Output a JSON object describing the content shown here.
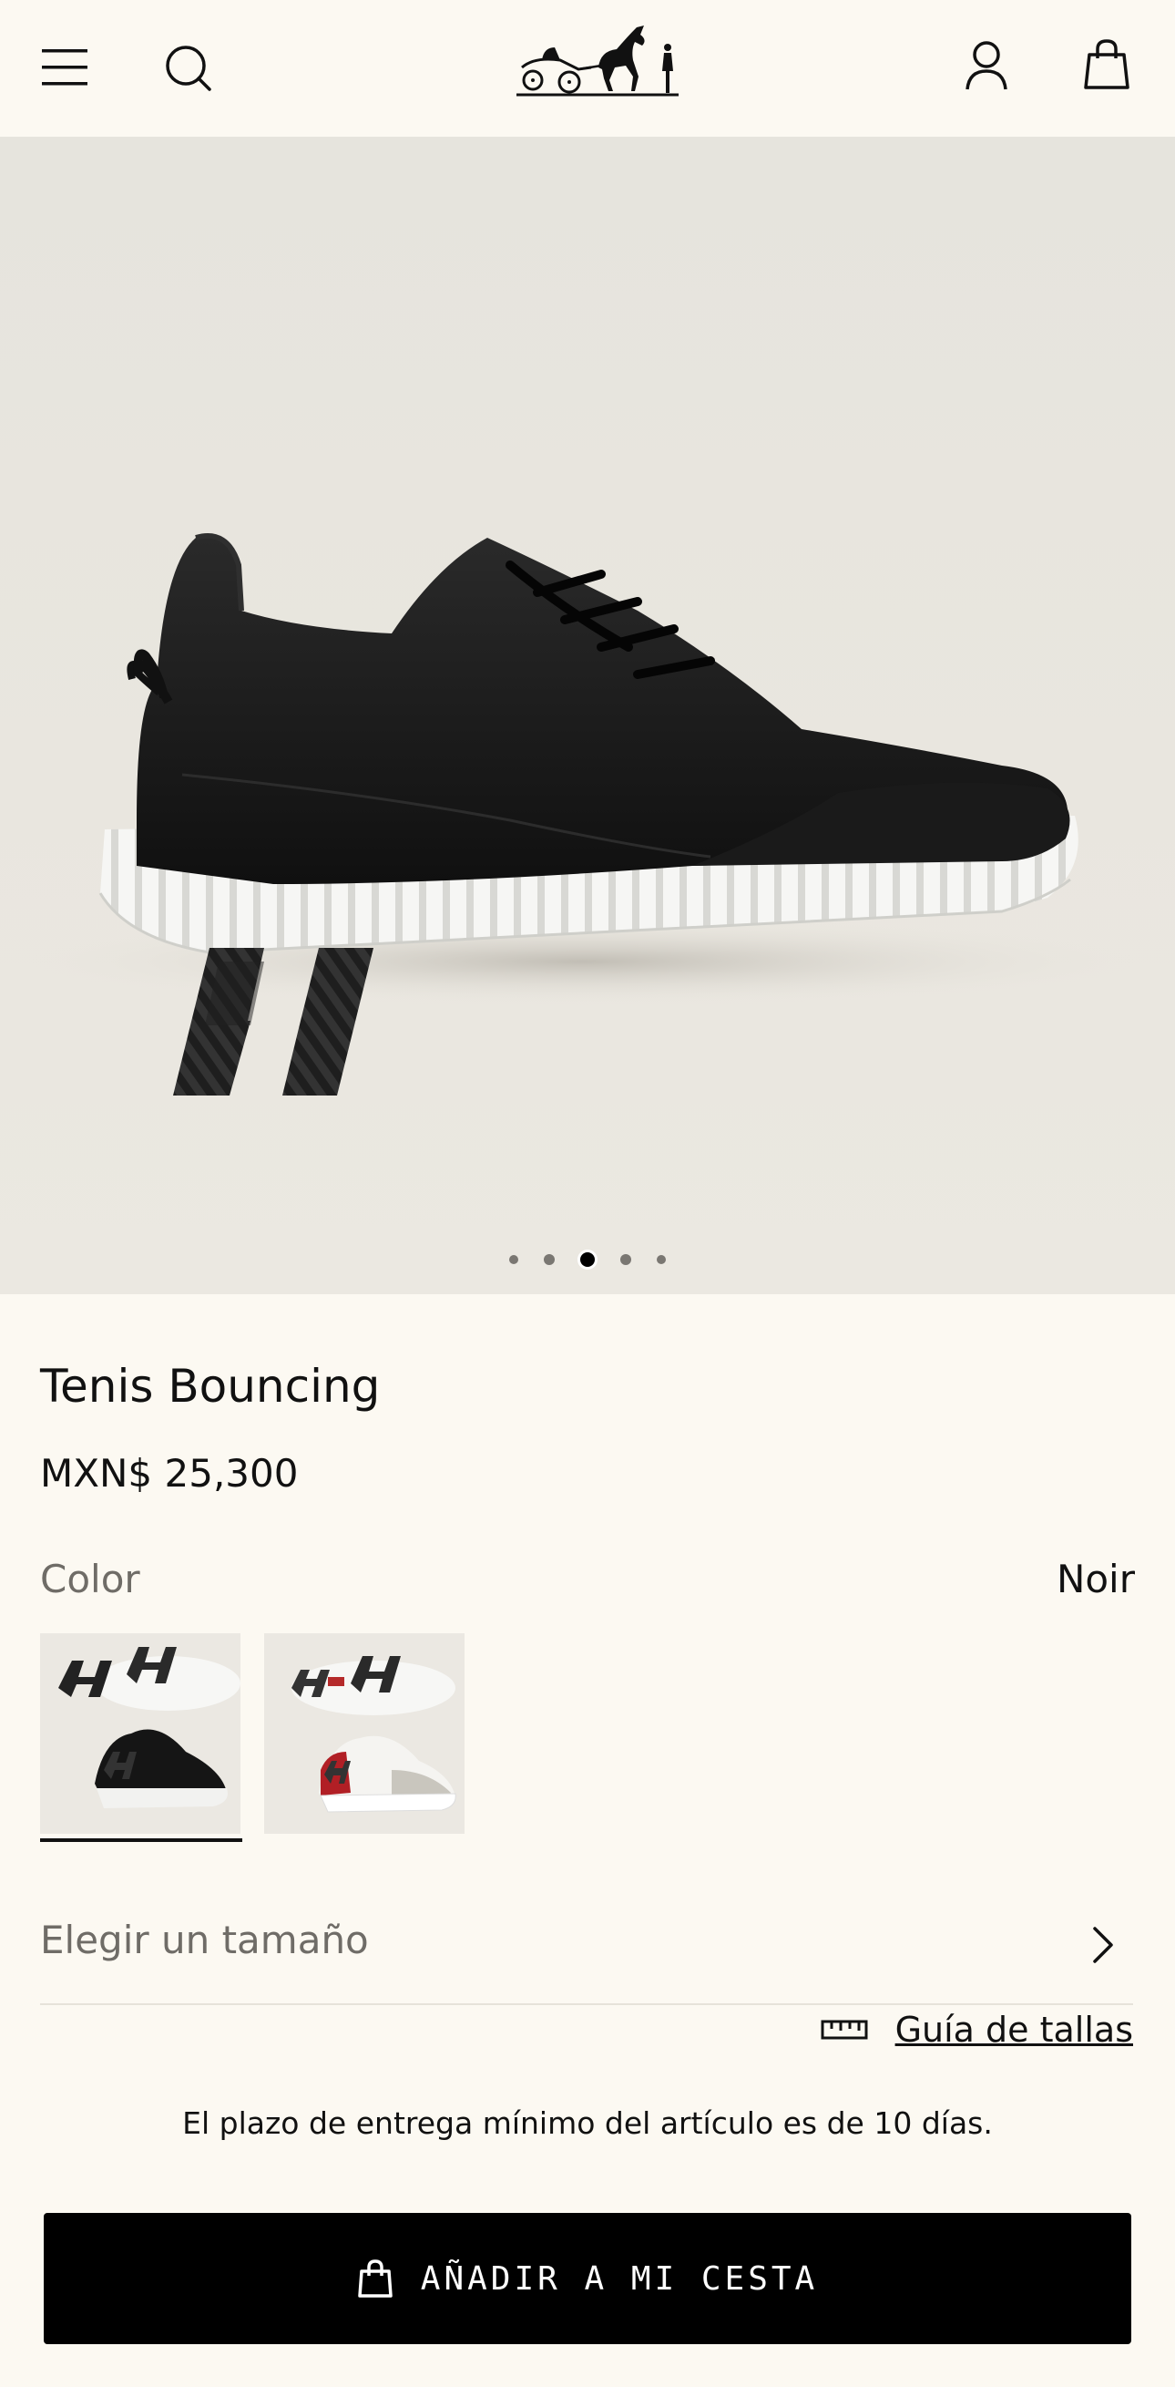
{
  "header": {
    "menu_icon": "menu-icon",
    "search_icon": "search-icon",
    "logo_icon": "carriage-logo-icon",
    "account_icon": "user-icon",
    "bag_icon": "shopping-bag-icon"
  },
  "gallery": {
    "image": "black sneaker with white ridged sole side view",
    "dot_count": 5,
    "active_index": 3
  },
  "product": {
    "title": "Tenis Bouncing",
    "price": "MXN$ 25,300"
  },
  "color": {
    "label": "Color",
    "selected": "Noir",
    "swatches": [
      {
        "name": "Noir",
        "selected": true
      },
      {
        "name": "Blanc / Rouge",
        "selected": false
      }
    ]
  },
  "size": {
    "placeholder": "Elegir un tamaño",
    "guide_label": "Guía de tallas",
    "guide_icon": "ruler-icon",
    "chevron_icon": "chevron-right-icon"
  },
  "delivery_note": "El plazo de entrega mínimo del artículo es de 10 días.",
  "cta": {
    "label": "AÑADIR A MI CESTA",
    "icon": "shopping-bag-icon"
  },
  "colors": {
    "background": "#fcf9f2",
    "text": "#111111",
    "muted": "#6f6c67",
    "button": "#000000"
  }
}
